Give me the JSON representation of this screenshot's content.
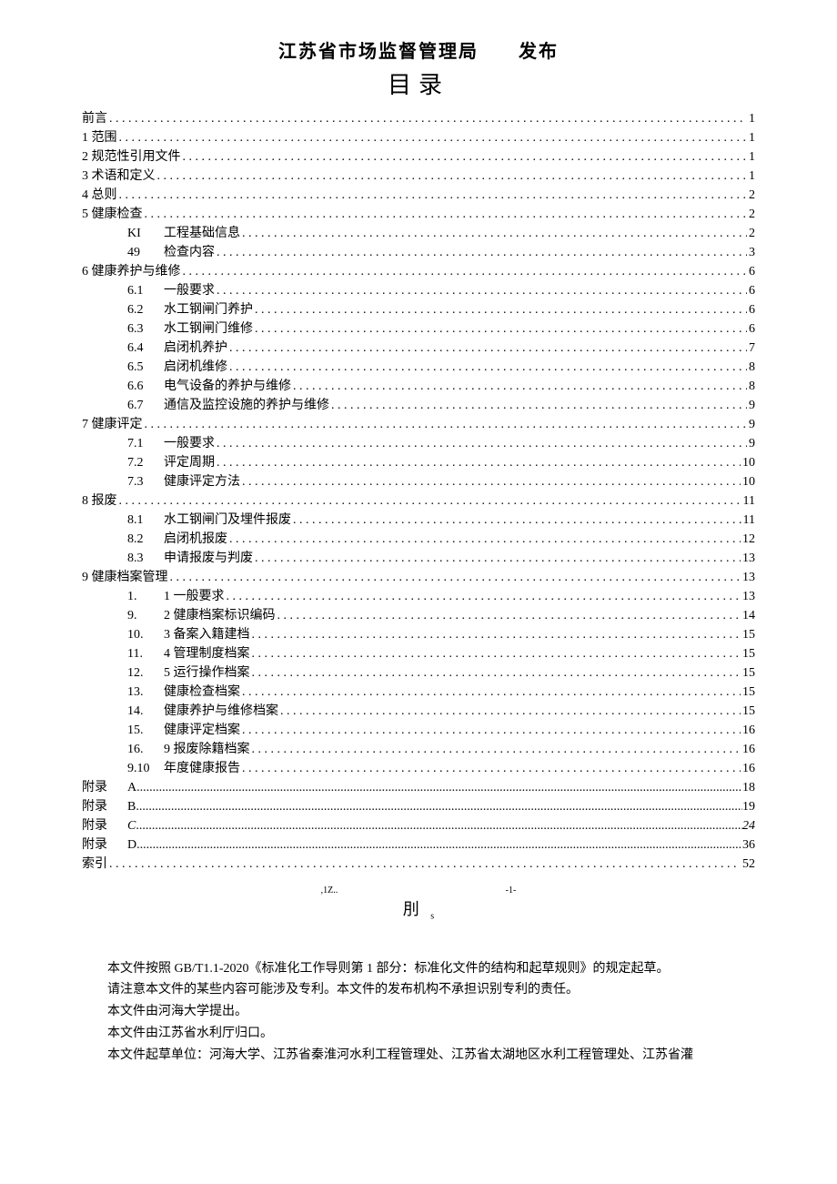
{
  "header": {
    "org": "江苏省市场监督管理局",
    "issue": "发布"
  },
  "toc_title": "目录",
  "toc_top": [
    {
      "label": "前言",
      "page": "1"
    },
    {
      "label": "1 范围",
      "page": "1"
    },
    {
      "label": "2 规范性引用文件",
      "page": "1"
    },
    {
      "label": "3 术语和定义",
      "page": "1"
    },
    {
      "label": "4 总则",
      "page": "2"
    },
    {
      "label": "5 健康检查",
      "page": "2"
    }
  ],
  "toc_5_sub": [
    {
      "num": "KI",
      "label": "工程基础信息",
      "page": "2"
    },
    {
      "num": "49",
      "label": "检查内容",
      "page": "3"
    }
  ],
  "toc_6": {
    "label": "6 健康养护与维修",
    "page": "6"
  },
  "toc_6_sub": [
    {
      "num": "6.1",
      "label": "一般要求",
      "page": "6"
    },
    {
      "num": "6.2",
      "label": "水工钢闸门养护",
      "page": "6"
    },
    {
      "num": "6.3",
      "label": "水工钢闸门维修",
      "page": "6"
    },
    {
      "num": "6.4",
      "label": "启闭机养护",
      "page": "7"
    },
    {
      "num": "6.5",
      "label": "启闭机维修",
      "page": "8"
    },
    {
      "num": "6.6",
      "label": "电气设备的养护与维修",
      "page": "8"
    },
    {
      "num": "6.7",
      "label": "通信及监控设施的养护与维修",
      "page": "9"
    }
  ],
  "toc_7": {
    "label": "7 健康评定",
    "page": "9"
  },
  "toc_7_sub": [
    {
      "num": "7.1",
      "label": "一般要求",
      "page": "9"
    },
    {
      "num": "7.2",
      "label": "评定周期",
      "page": "10"
    },
    {
      "num": "7.3",
      "label": "健康评定方法",
      "page": "10"
    }
  ],
  "toc_8": {
    "label": "8 报废",
    "page": "11"
  },
  "toc_8_sub": [
    {
      "num": "8.1",
      "label": "水工钢闸门及埋件报废",
      "page": "11"
    },
    {
      "num": "8.2",
      "label": "启闭机报废",
      "page": "12"
    },
    {
      "num": "8.3",
      "label": "申请报废与判废",
      "page": "13"
    }
  ],
  "toc_9": {
    "label": "9 健康档案管理",
    "page": "13"
  },
  "toc_9_sub": [
    {
      "num": "1.",
      "label": "1 一般要求",
      "page": "13"
    },
    {
      "num": "9.",
      "label": "2 健康档案标识编码",
      "page": "14"
    },
    {
      "num": "10.",
      "label": "3 备案入籍建档",
      "page": "15"
    },
    {
      "num": "11.",
      "label": "4 管理制度档案",
      "page": "15"
    },
    {
      "num": "12.",
      "label": "5 运行操作档案",
      "page": "15"
    },
    {
      "num": "13.",
      "label": "健康检查档案",
      "page": "15"
    },
    {
      "num": "14.",
      "label": "健康养护与维修档案",
      "page": "15"
    },
    {
      "num": "15.",
      "label": "健康评定档案",
      "page": "16"
    },
    {
      "num": "16.",
      "label": "9 报废除籍档案",
      "page": "16"
    },
    {
      "num": "9.10",
      "label": "年度健康报告",
      "page": "16"
    }
  ],
  "appendix": [
    {
      "prefix": "附录",
      "letter": "A",
      "page": "18"
    },
    {
      "prefix": "附录",
      "letter": "B",
      "page": "19"
    },
    {
      "prefix": "附录",
      "letter": "C",
      "page": "24",
      "italic": true
    },
    {
      "prefix": "附录",
      "letter": "D",
      "page": "36"
    }
  ],
  "index": {
    "label": "索引",
    "page": "52"
  },
  "footer": {
    "small1": ",1Z..",
    "small2": "-1-",
    "small3": "s",
    "word": "刖"
  },
  "body": [
    "本文件按照 GB/T1.1-2020《标准化工作导则第 1 部分：标准化文件的结构和起草规则》的规定起草。",
    "请注意本文件的某些内容可能涉及专利。本文件的发布机构不承担识别专利的责任。",
    "本文件由河海大学提出。",
    "本文件由江苏省水利厅归口。",
    "本文件起草单位：河海大学、江苏省秦淮河水利工程管理处、江苏省太湖地区水利工程管理处、江苏省灌"
  ]
}
